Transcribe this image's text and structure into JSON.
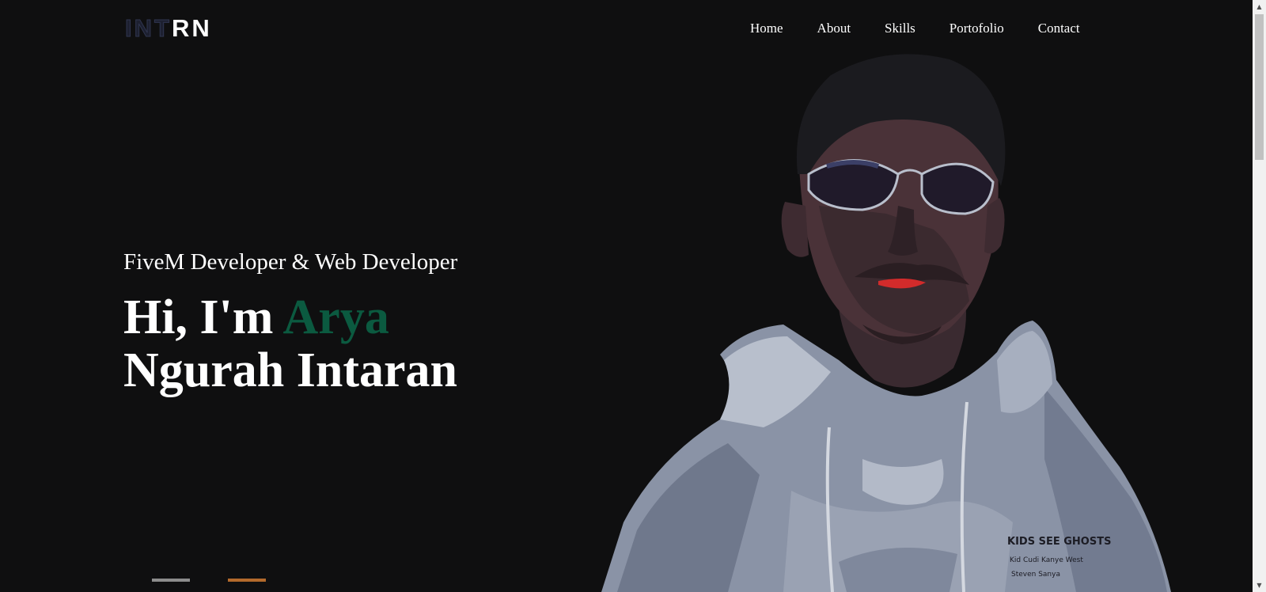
{
  "header": {
    "logo_dim": "INT",
    "logo_bright": "RN",
    "nav": [
      {
        "label": "Home"
      },
      {
        "label": "About"
      },
      {
        "label": "Skills"
      },
      {
        "label": "Portofolio"
      },
      {
        "label": "Contact"
      }
    ]
  },
  "hero": {
    "subtitle": "FiveM Developer & Web Developer",
    "greeting": "Hi, I'm ",
    "first_name": "Arya",
    "last_name": "Ngurah Intaran",
    "hoodie_print": [
      "KIDS SEE GHOSTS",
      "Kid Cudi Kanye West",
      "Steven Sanya"
    ]
  },
  "colors": {
    "background": "#0f0f10",
    "accent": "#0b5a40",
    "text": "#ffffff"
  },
  "icons": {
    "scroll_up": "triangle-up-icon",
    "scroll_down": "triangle-down-icon"
  }
}
